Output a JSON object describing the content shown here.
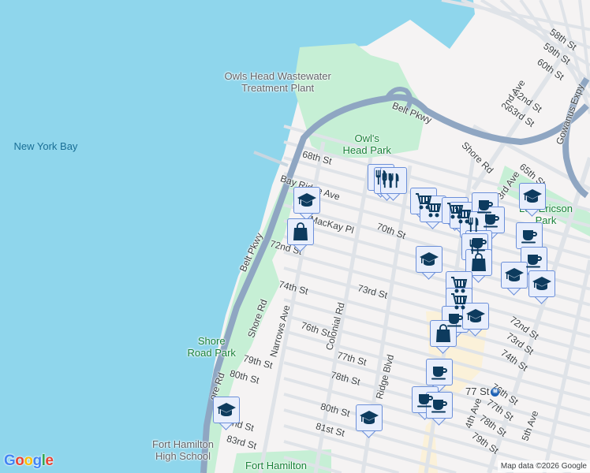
{
  "map": {
    "water_labels": [
      "New York Bay"
    ],
    "park_labels": [
      "Owl's\nHead Park",
      "Shore\nRoad Park",
      "Fort Hamilton",
      "Leif Ericson\nPark"
    ],
    "poi_labels": [
      "Owls Head Wastewater\nTreatment Plant",
      "Fort Hamilton\nHigh School"
    ],
    "street_labels": [
      "58th St",
      "59th St",
      "60th St",
      "62nd St",
      "63rd St",
      "2nd Ave",
      "Gowanus Expy",
      "Belt Pkwy",
      "Shore Rd",
      "3rd Ave",
      "65th St",
      "68th St",
      "Bay Ridge Ave",
      "MacKay Pl",
      "70th St",
      "72nd St",
      "Belt Pkwy",
      "74th St",
      "73rd St",
      "Shore Rd",
      "Narrows Ave",
      "76th St",
      "Colonial Rd",
      "Ridge Blvd",
      "77th St",
      "78th St",
      "79th St",
      "80th St",
      "80th St",
      "81st St",
      "82nd St",
      "83rd St",
      "72nd St",
      "73rd St",
      "74th St",
      "76th St",
      "77th St",
      "78th St",
      "79th St",
      "4th Ave",
      "5th Ave",
      "ore Rd"
    ],
    "transit_label": "77 St",
    "transit_icon": "subway-icon",
    "markers": [
      "restaurant",
      "restaurant",
      "restaurant",
      "school",
      "shopping-bag",
      "cart",
      "cart",
      "cart",
      "cart",
      "coffee",
      "coffee",
      "restaurant",
      "school",
      "coffee",
      "coffee",
      "coffee",
      "restaurant",
      "shopping-bag",
      "school",
      "school",
      "school",
      "cart",
      "cart",
      "coffee",
      "school",
      "shopping-bag",
      "coffee",
      "coffee",
      "coffee",
      "school",
      "school"
    ],
    "colors": {
      "water": "#8fd6ec",
      "land": "#f5f3f3",
      "park": "#c6efd5",
      "highway": "#8fa6c2",
      "marker_fill": "#e8eefc",
      "marker_border": "#6b8fd9",
      "icon": "#0d3b5e"
    }
  },
  "attribution": "Map data ©2026 Google",
  "logo": "Google"
}
